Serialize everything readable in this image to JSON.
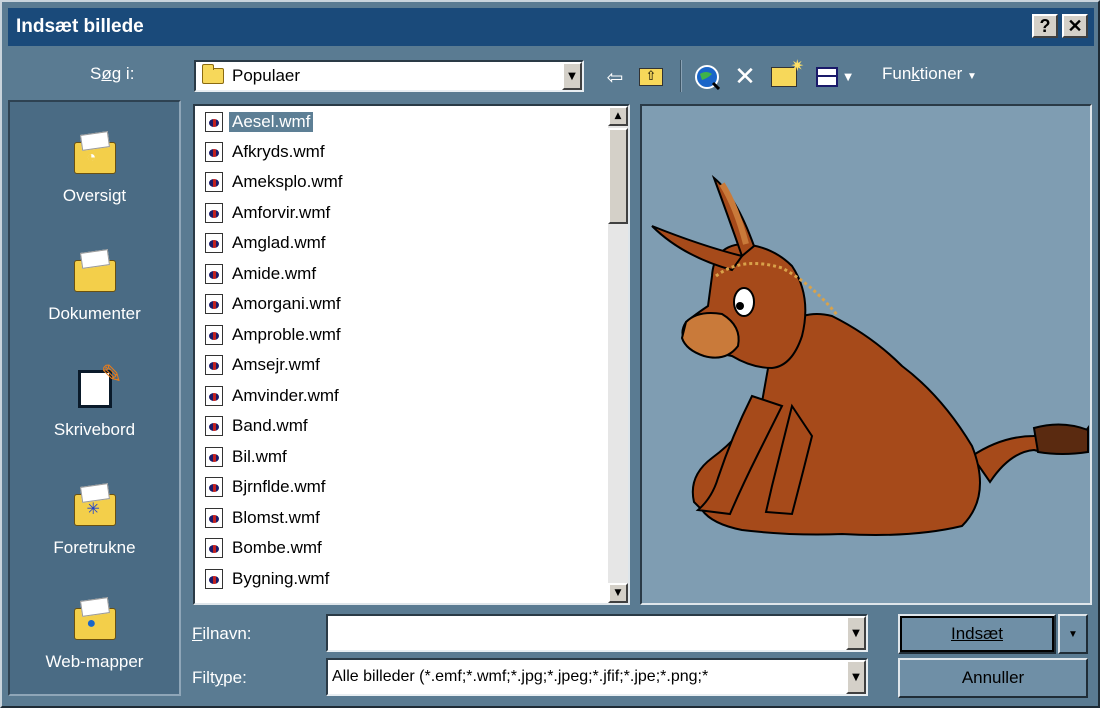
{
  "window": {
    "title": "Indsæt billede",
    "help_label": "?",
    "close_label": "✕"
  },
  "toolbar": {
    "look_in_label": "Søg i:",
    "location_value": "Populaer",
    "functions_label": "Funktioner",
    "icons": [
      "back-arrow-icon",
      "up-folder-icon",
      "search-web-icon",
      "delete-icon",
      "new-folder-icon",
      "views-icon"
    ]
  },
  "places": [
    {
      "label": "Oversigt",
      "icon": "history-folder-icon"
    },
    {
      "label": "Dokumenter",
      "icon": "documents-folder-icon"
    },
    {
      "label": "Skrivebord",
      "icon": "desktop-icon"
    },
    {
      "label": "Foretrukne",
      "icon": "favorites-folder-icon"
    },
    {
      "label": "Web-mapper",
      "icon": "web-folders-icon"
    }
  ],
  "files": [
    "Aesel.wmf",
    "Afkryds.wmf",
    "Ameksplo.wmf",
    "Amforvir.wmf",
    "Amglad.wmf",
    "Amide.wmf",
    "Amorgani.wmf",
    "Amproble.wmf",
    "Amsejr.wmf",
    "Amvinder.wmf",
    "Band.wmf",
    "Bil.wmf",
    "Bjrnflde.wmf",
    "Blomst.wmf",
    "Bombe.wmf",
    "Bygning.wmf"
  ],
  "selected_file": "Aesel.wmf",
  "filename": {
    "label": "Filnavn:",
    "value": ""
  },
  "filetype": {
    "label": "Filtype:",
    "value": "Alle billeder (*.emf;*.wmf;*.jpg;*.jpeg;*.jfif;*.jpe;*.png;*"
  },
  "buttons": {
    "insert_label": "Indsæt",
    "cancel_label": "Annuller"
  },
  "colors": {
    "titlebar": "#1a4a7a",
    "dialog": "#5a7b92",
    "preview_bg": "#7f9db2",
    "selection": "#5d7f95"
  }
}
